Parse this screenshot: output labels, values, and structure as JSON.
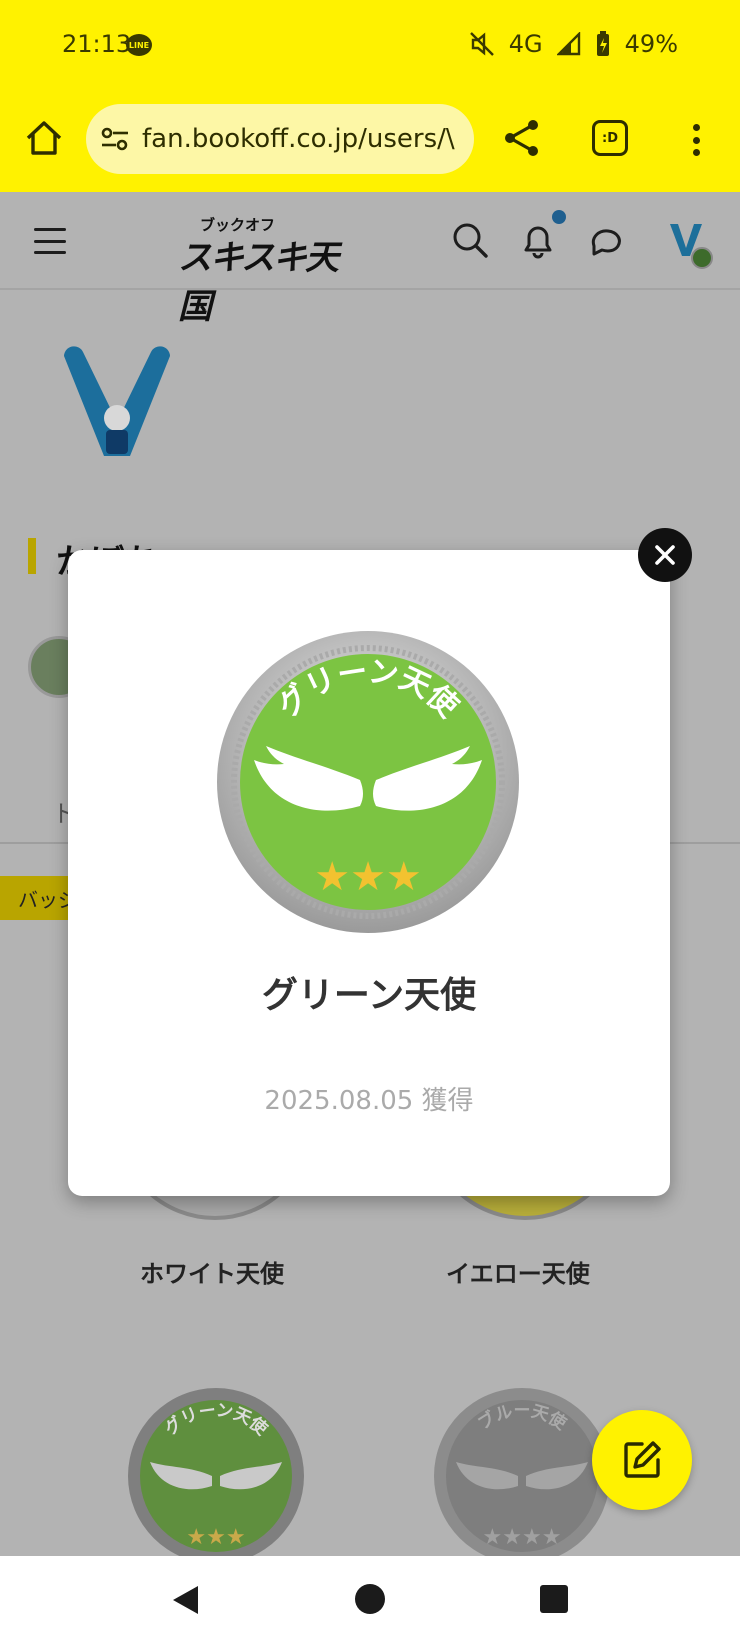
{
  "status_bar": {
    "time": "21:13",
    "line_badge": "LINE",
    "network": "4G",
    "battery": "49%"
  },
  "browser": {
    "url": "fan.bookoff.co.jp/users/\\",
    "tab_label": ":D"
  },
  "site": {
    "logo_small": "ブックオフ",
    "logo_big": "スキスキ天国"
  },
  "profile": {
    "name": "かぼちゃ",
    "tab_partial": "ト",
    "section_chip": "バッジ"
  },
  "badges": [
    {
      "label": "ホワイト天使"
    },
    {
      "label": "イエロー天使"
    }
  ],
  "badge_arc_texts": {
    "green": "グリーン天使",
    "blue": "ブルー天使"
  },
  "modal": {
    "badge_name": "グリーン天使",
    "earned_date": "2025.08.05 獲得",
    "badge_arc_text": "グリーン天使"
  },
  "colors": {
    "brand_yellow": "#fff200",
    "badge_green": "#7cc442",
    "badge_gray": "#9a9a9a"
  }
}
